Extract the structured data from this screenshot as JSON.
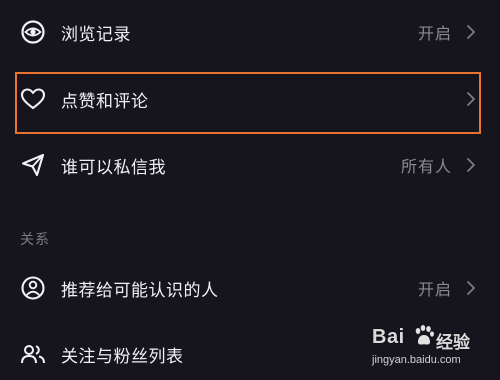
{
  "privacy_list": {
    "history": {
      "label": "浏览记录",
      "value": "开启",
      "icon": "eye-icon"
    },
    "likes": {
      "label": "点赞和评论",
      "value": "",
      "icon": "heart-icon"
    },
    "dm": {
      "label": "谁可以私信我",
      "value": "所有人",
      "icon": "paper-plane-icon"
    }
  },
  "relations_section": {
    "header": "关系",
    "recommend": {
      "label": "推荐给可能认识的人",
      "value": "开启",
      "icon": "person-circle-icon"
    },
    "follow": {
      "label": "关注与粉丝列表",
      "value": "",
      "icon": "people-icon"
    }
  },
  "highlight_color": "#e8722f",
  "watermark": {
    "brand": "Bai",
    "brand_suffix": "经验",
    "url": "jingyan.baidu.com"
  }
}
